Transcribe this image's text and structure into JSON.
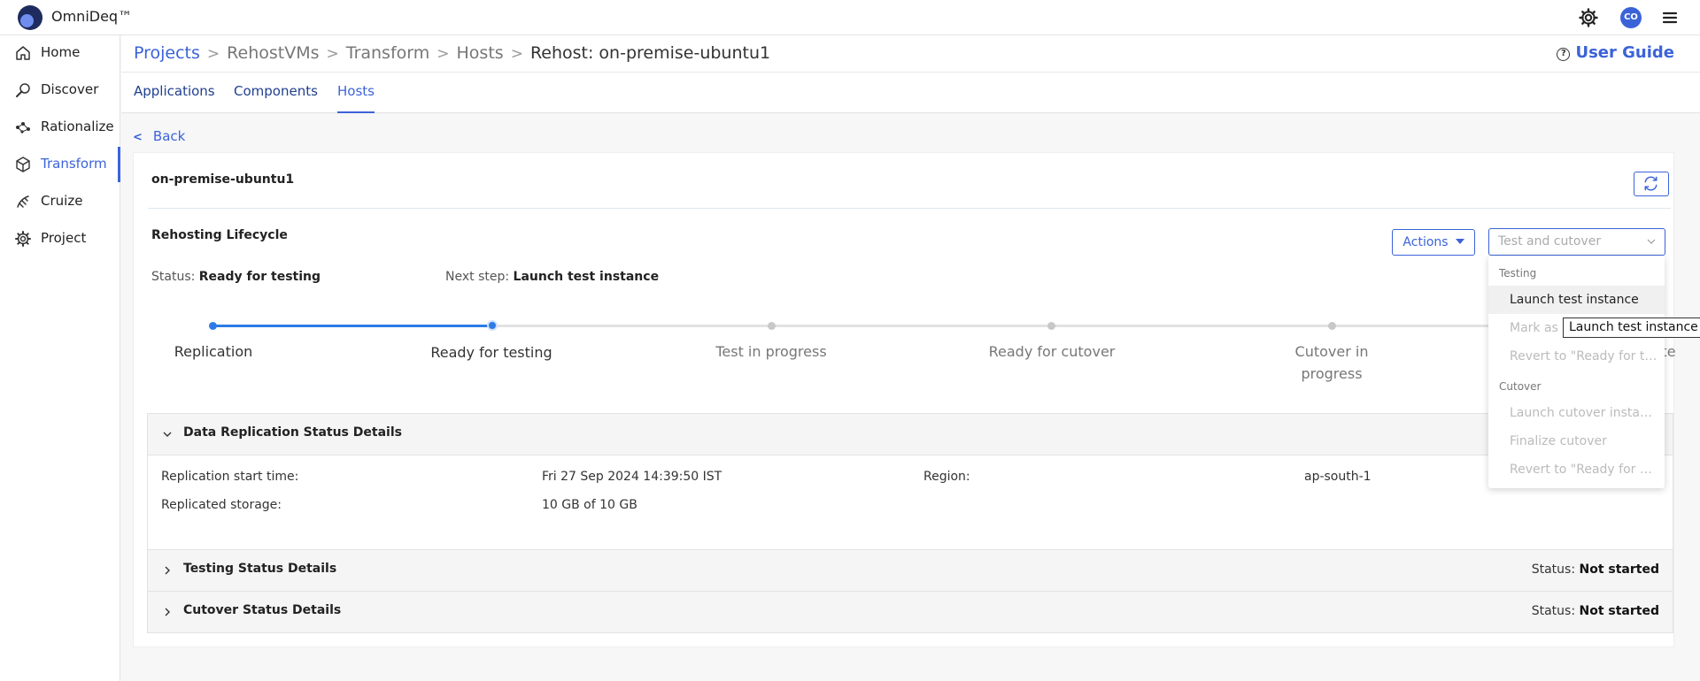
{
  "app": {
    "brand": "OmniDeq™",
    "avatar_initials": "CO"
  },
  "sidebar": {
    "items": [
      {
        "label": "Home",
        "icon": "home-icon"
      },
      {
        "label": "Discover",
        "icon": "discover-icon"
      },
      {
        "label": "Rationalize",
        "icon": "rationalize-icon"
      },
      {
        "label": "Transform",
        "icon": "cube-icon",
        "active": true
      },
      {
        "label": "Cruize",
        "icon": "cruize-icon"
      },
      {
        "label": "Project",
        "icon": "gear-icon"
      }
    ]
  },
  "breadcrumb": {
    "items": [
      "Projects",
      "RehostVMs",
      "Transform",
      "Hosts",
      "Rehost: on-premise-ubuntu1"
    ],
    "separator": ">"
  },
  "user_guide": {
    "label": "User Guide",
    "icon_glyph": "?"
  },
  "tabs": [
    "Applications",
    "Components",
    "Hosts"
  ],
  "active_tab": "Hosts",
  "back": {
    "label": "Back",
    "glyph": "<"
  },
  "host": {
    "name": "on-premise-ubuntu1"
  },
  "lifecycle": {
    "title": "Rehosting Lifecycle",
    "status_label": "Status:",
    "status_value": "Ready for testing",
    "next_step_label": "Next step:",
    "next_step_value": "Launch test instance",
    "actions_label": "Actions",
    "select_placeholder": "Test and cutover",
    "steps": [
      {
        "label": "Replication",
        "state": "done"
      },
      {
        "label": "Ready for testing",
        "state": "active"
      },
      {
        "label": "Test in progress",
        "state": "todo"
      },
      {
        "label": "Ready for cutover",
        "state": "todo"
      },
      {
        "label": "Cutover in progress",
        "state": "todo"
      },
      {
        "label": "Cutover complete",
        "state": "todo"
      }
    ]
  },
  "sections": {
    "replication": {
      "title": "Data Replication Status Details",
      "start_time_label": "Replication start time:",
      "start_time_value": "Fri 27 Sep 2024 14:39:50 IST",
      "region_label": "Region:",
      "region_value": "ap-south-1",
      "storage_label": "Replicated storage:",
      "storage_value": "10 GB of 10 GB"
    },
    "testing": {
      "title": "Testing Status Details",
      "status_label": "Status:",
      "status_value": "Not started"
    },
    "cutover": {
      "title": "Cutover Status Details",
      "status_label": "Status:",
      "status_value": "Not started"
    }
  },
  "dropdown": {
    "groups": [
      {
        "label": "Testing",
        "items": [
          {
            "label": "Launch test instance",
            "enabled": true
          },
          {
            "label": "Mark as \"Ready for cutover\"",
            "enabled": false
          },
          {
            "label": "Revert to \"Ready for testing\"",
            "enabled": false
          }
        ]
      },
      {
        "label": "Cutover",
        "items": [
          {
            "label": "Launch cutover instances",
            "enabled": false
          },
          {
            "label": "Finalize cutover",
            "enabled": false
          },
          {
            "label": "Revert to \"Ready for cutover\"",
            "enabled": false
          }
        ]
      }
    ],
    "tooltip": "Launch test instance"
  },
  "colors": {
    "accent": "#3b63d8",
    "progress": "#2d7be5",
    "brand_dark": "#1e2b5e"
  }
}
